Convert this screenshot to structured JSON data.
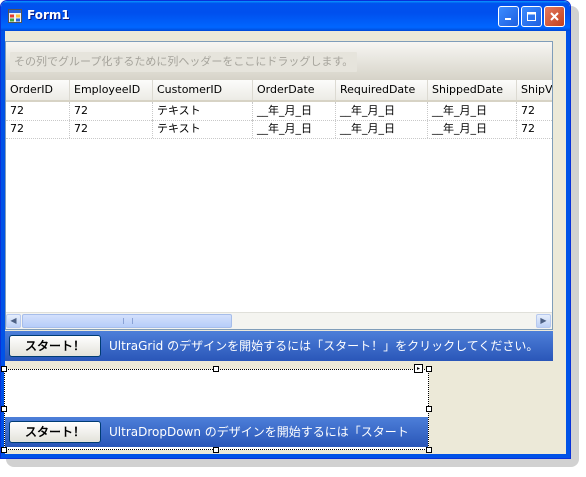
{
  "window": {
    "title": "Form1",
    "icon": "app-form-icon"
  },
  "titlebar_buttons": {
    "minimize": "minimize-icon",
    "maximize": "maximize-icon",
    "close": "close-icon"
  },
  "grid": {
    "group_hint": "その列でグループ化するために列ヘッダーをここにドラッグします。",
    "columns": [
      "OrderID",
      "EmployeeID",
      "CustomerID",
      "OrderDate",
      "RequiredDate",
      "ShippedDate",
      "ShipV"
    ],
    "rows": [
      [
        "72",
        "72",
        "テキスト",
        "__年_月_日",
        "__年_月_日",
        "__年_月_日",
        "72"
      ],
      [
        "72",
        "72",
        "テキスト",
        "__年_月_日",
        "__年_月_日",
        "__年_月_日",
        "72"
      ]
    ],
    "scroll_left": "◀",
    "scroll_right": "▶"
  },
  "grid_banner": {
    "button_label": "スタート！",
    "text": "UltraGrid のデザインを開始するには「スタート！」をクリックしてください。"
  },
  "dropdown_banner": {
    "button_label": "スタート！",
    "text": "UltraDropDown のデザインを開始するには「スタート"
  },
  "dropdown_smart_tag": "▸",
  "colors": {
    "titlebar": "#0053ee",
    "banner": "#3a68c8",
    "frame": "#0052e7"
  }
}
